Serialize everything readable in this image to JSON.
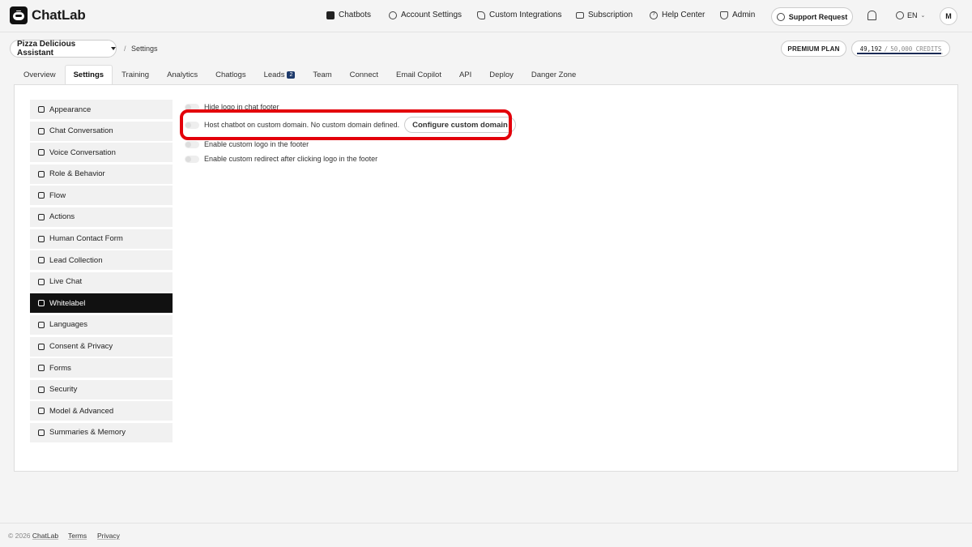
{
  "app": {
    "name": "ChatLab"
  },
  "nav": {
    "chatbots": "Chatbots",
    "account_settings": "Account Settings",
    "custom_integrations": "Custom Integrations",
    "subscription": "Subscription",
    "help_center": "Help Center",
    "admin": "Admin",
    "support_request": "Support Request",
    "language": "EN",
    "avatar_initial": "M"
  },
  "subheader": {
    "bot_name": "Pizza Delicious Assistant",
    "breadcrumb_sep": "/",
    "breadcrumb": "Settings",
    "plan": "PREMIUM PLAN",
    "credits_used": "49,192",
    "credits_sep": "/",
    "credits_total": "50,000 CREDITS",
    "credits_fraction": 0.984
  },
  "tabs": [
    {
      "label": "Overview"
    },
    {
      "label": "Settings"
    },
    {
      "label": "Training"
    },
    {
      "label": "Analytics"
    },
    {
      "label": "Chatlogs"
    },
    {
      "label": "Leads",
      "badge": "2"
    },
    {
      "label": "Team"
    },
    {
      "label": "Connect"
    },
    {
      "label": "Email Copilot"
    },
    {
      "label": "API"
    },
    {
      "label": "Deploy"
    },
    {
      "label": "Danger Zone"
    }
  ],
  "sidebar": {
    "items": [
      {
        "label": "Appearance",
        "icon": "monitor-icon"
      },
      {
        "label": "Chat Conversation",
        "icon": "chat-bubble-icon"
      },
      {
        "label": "Voice Conversation",
        "icon": "microphone-icon"
      },
      {
        "label": "Role & Behavior",
        "icon": "user-icon"
      },
      {
        "label": "Flow",
        "icon": "flow-icon"
      },
      {
        "label": "Actions",
        "icon": "actions-icon"
      },
      {
        "label": "Human Contact Form",
        "icon": "contact-icon"
      },
      {
        "label": "Lead Collection",
        "icon": "lead-icon"
      },
      {
        "label": "Live Chat",
        "icon": "headset-icon"
      },
      {
        "label": "Whitelabel",
        "icon": "pen-icon"
      },
      {
        "label": "Languages",
        "icon": "translate-icon"
      },
      {
        "label": "Consent & Privacy",
        "icon": "shield-icon"
      },
      {
        "label": "Forms",
        "icon": "form-icon"
      },
      {
        "label": "Security",
        "icon": "lock-icon"
      },
      {
        "label": "Model & Advanced",
        "icon": "flask-icon"
      },
      {
        "label": "Summaries & Memory",
        "icon": "keyboard-icon"
      }
    ]
  },
  "whitelabel": {
    "hide_logo": "Hide logo in chat footer",
    "host_custom_domain": "Host chatbot on custom domain. No custom domain defined.",
    "configure_domain": "Configure custom domain",
    "custom_logo": "Enable custom logo in the footer",
    "custom_redirect": "Enable custom redirect after clicking logo in the footer"
  },
  "footer": {
    "copyright": "© 2026",
    "brand": "ChatLab",
    "terms": "Terms",
    "privacy": "Privacy"
  },
  "colors": {
    "highlight": "#e3000b",
    "accent_badge": "#1e3a6b"
  }
}
